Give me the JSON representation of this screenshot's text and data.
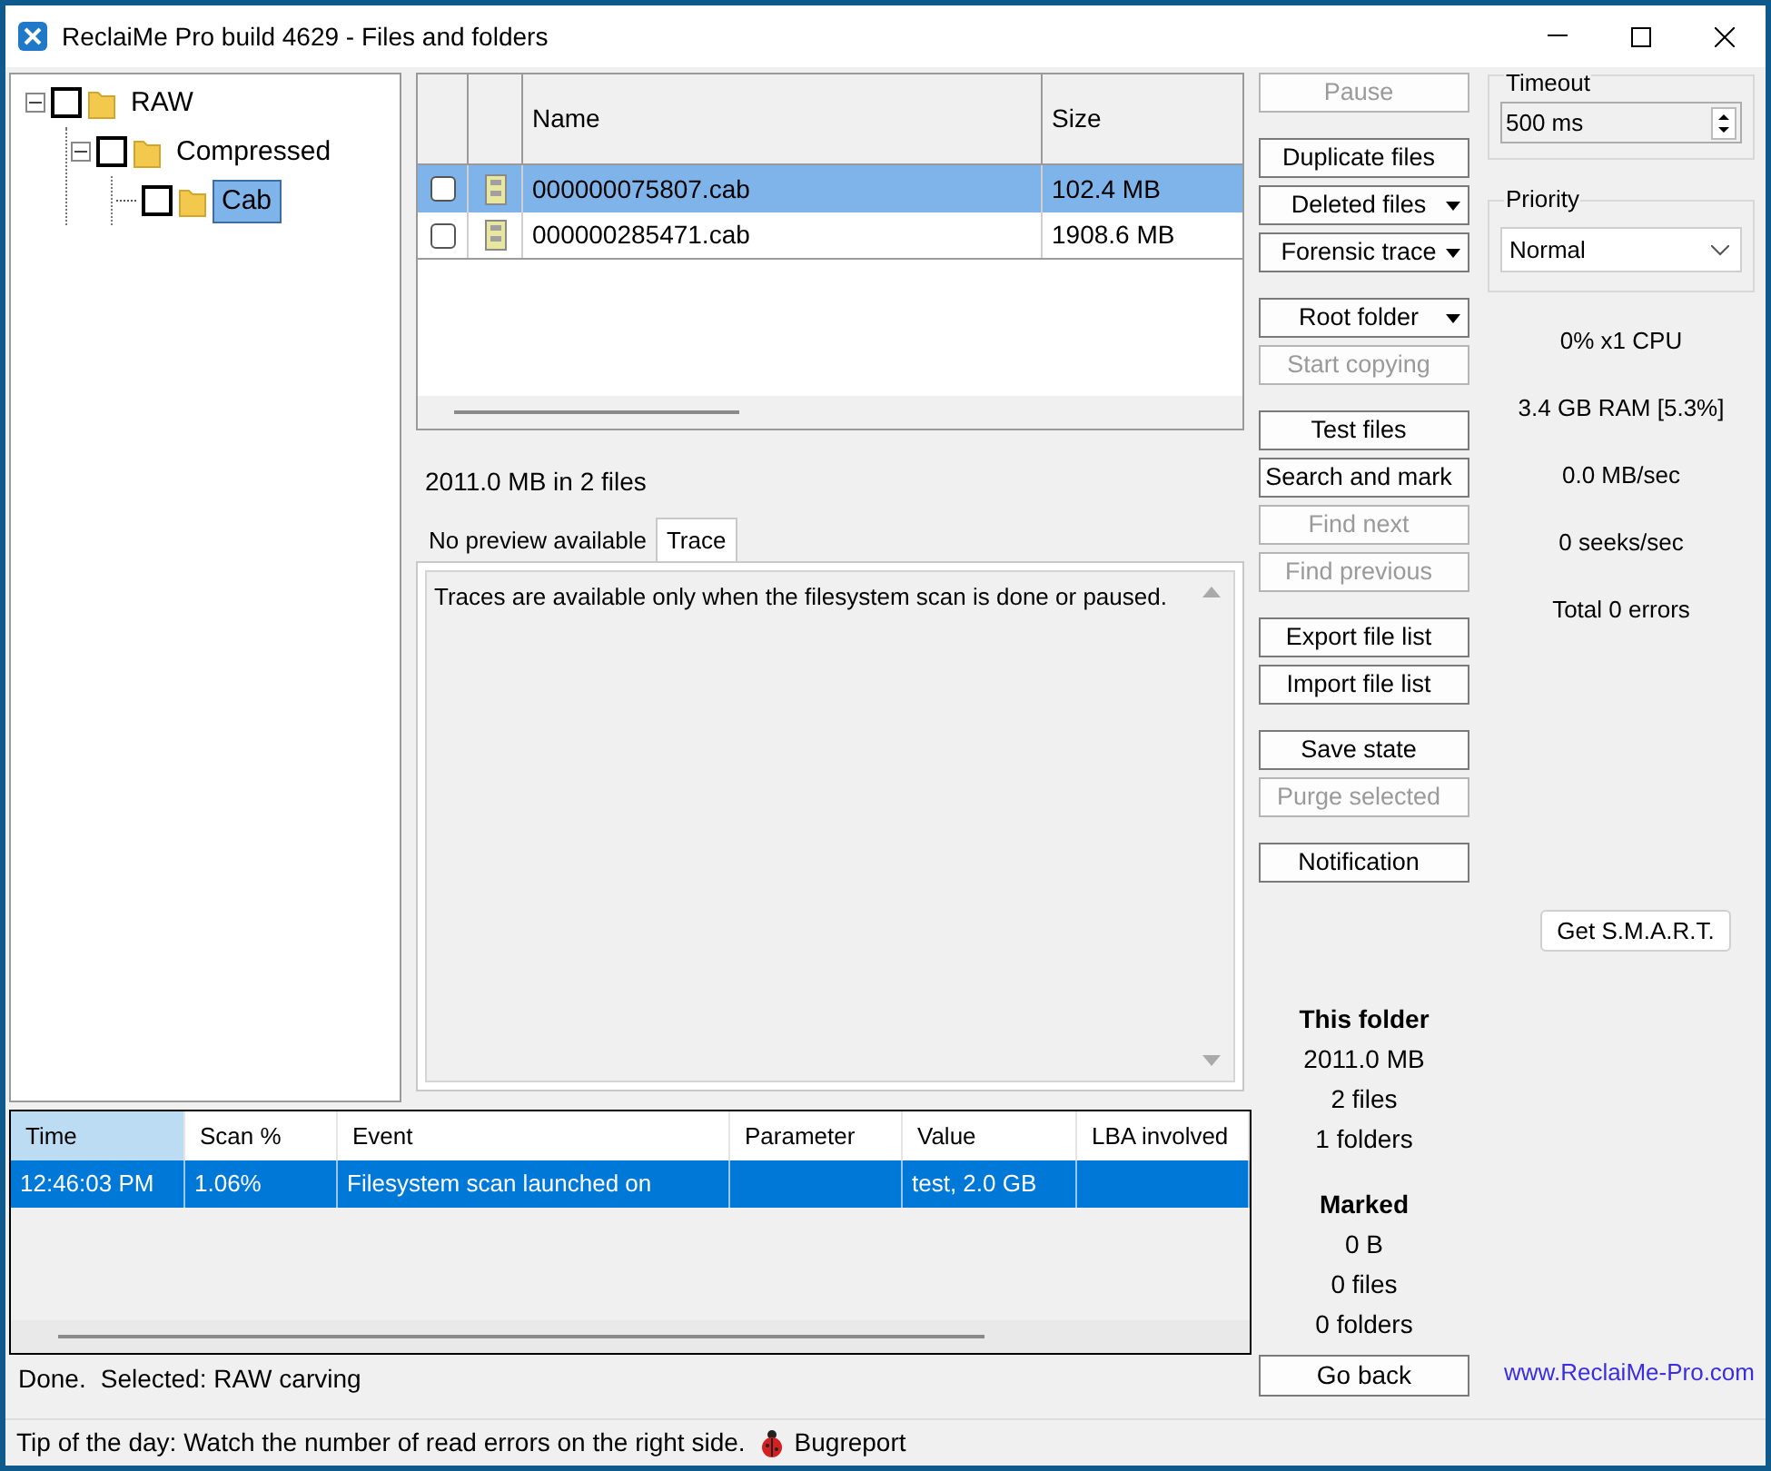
{
  "window": {
    "title": "ReclaiMe Pro build 4629 - Files and folders"
  },
  "tree": [
    {
      "label": "RAW",
      "expanded": true,
      "checked": false,
      "selected": false,
      "children": [
        {
          "label": "Compressed",
          "expanded": true,
          "checked": false,
          "selected": false,
          "children": [
            {
              "label": "Cab",
              "checked": false,
              "selected": true
            }
          ]
        }
      ]
    }
  ],
  "files": {
    "columns": [
      "Name",
      "Size"
    ],
    "rows": [
      {
        "name": "000000075807.cab",
        "size": "102.4 MB",
        "checked": false,
        "selected": true
      },
      {
        "name": "000000285471.cab",
        "size": "1908.6 MB",
        "checked": false,
        "selected": false
      }
    ],
    "summary": "2011.0 MB in 2 files"
  },
  "preview": {
    "tabs": [
      {
        "label": "No preview available",
        "selected": false
      },
      {
        "label": "Trace",
        "selected": true
      }
    ],
    "text": "Traces are available only when the filesystem scan is done or paused."
  },
  "button_groups": [
    [
      {
        "label": "Pause",
        "disabled": true,
        "dropdown": false
      }
    ],
    [
      {
        "label": "Duplicate files",
        "disabled": false,
        "dropdown": false
      },
      {
        "label": "Deleted files",
        "disabled": false,
        "dropdown": true
      },
      {
        "label": "Forensic trace",
        "disabled": false,
        "dropdown": true
      }
    ],
    [
      {
        "label": "Root folder",
        "disabled": false,
        "dropdown": true
      },
      {
        "label": "Start copying",
        "disabled": true,
        "dropdown": false
      }
    ],
    [
      {
        "label": "Test files",
        "disabled": false,
        "dropdown": false
      },
      {
        "label": "Search and mark",
        "disabled": false,
        "dropdown": false
      },
      {
        "label": "Find next",
        "disabled": true,
        "dropdown": false
      },
      {
        "label": "Find previous",
        "disabled": true,
        "dropdown": false
      }
    ],
    [
      {
        "label": "Export file list",
        "disabled": false,
        "dropdown": false
      },
      {
        "label": "Import file list",
        "disabled": false,
        "dropdown": false
      }
    ],
    [
      {
        "label": "Save state",
        "disabled": false,
        "dropdown": false
      },
      {
        "label": "Purge selected",
        "disabled": true,
        "dropdown": false
      }
    ],
    [
      {
        "label": "Notification",
        "disabled": false,
        "dropdown": false
      }
    ]
  ],
  "this_folder": {
    "title": "This folder",
    "lines": [
      "2011.0 MB",
      "2 files",
      "1 folders"
    ]
  },
  "marked": {
    "title": "Marked",
    "lines": [
      "0 B",
      "0 files",
      "0 folders"
    ]
  },
  "go_back": "Go back",
  "log": {
    "columns": [
      {
        "label": "Time",
        "selected": true
      },
      {
        "label": "Scan %",
        "selected": false
      },
      {
        "label": "Event",
        "selected": false
      },
      {
        "label": "Parameter",
        "selected": false
      },
      {
        "label": "Value",
        "selected": false
      },
      {
        "label": "LBA involved",
        "selected": false
      }
    ],
    "rows": [
      {
        "cells": [
          "12:46:03 PM",
          "1.06%",
          "Filesystem scan launched on",
          "",
          "test, 2.0 GB",
          ""
        ],
        "selected": true
      }
    ]
  },
  "status": [
    "Done.",
    "Selected: RAW carving"
  ],
  "settings": {
    "timeout_label": "Timeout",
    "timeout": "500 ms",
    "priority_label": "Priority",
    "priority": "Normal"
  },
  "stats": [
    "0% x1 CPU",
    "3.4 GB RAM [5.3%]",
    "0.0 MB/sec",
    "0 seeks/sec",
    "Total 0 errors"
  ],
  "smart_button": "Get S.M.A.R.T.",
  "website": "www.ReclaiMe-Pro.com",
  "tip": "Tip of the day: Watch the number of read errors on the right side.",
  "bugreport": "Bugreport"
}
